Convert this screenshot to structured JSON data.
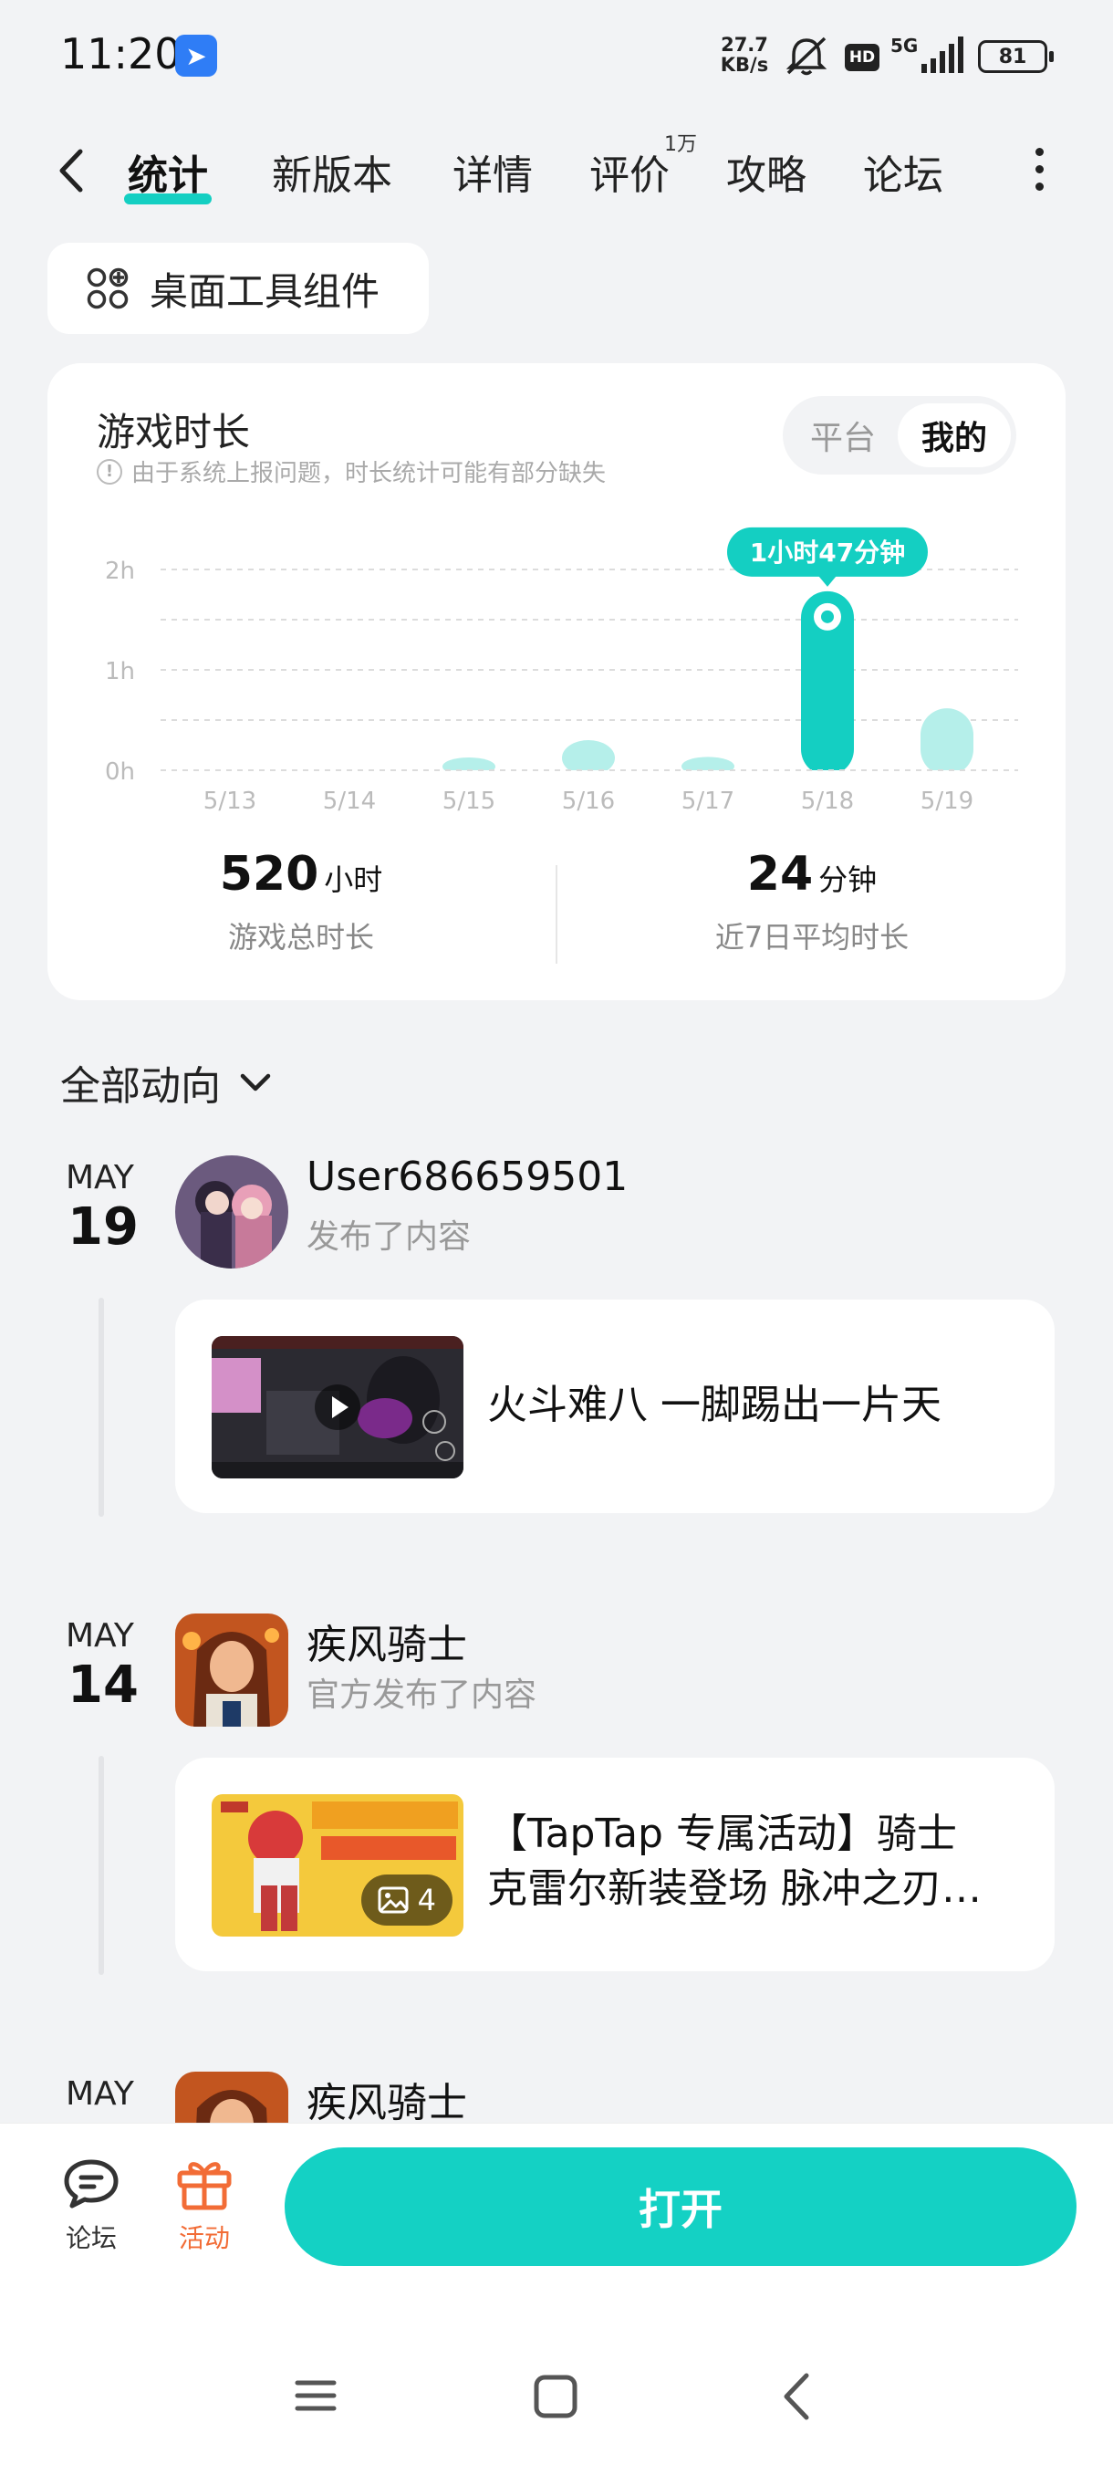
{
  "status_bar": {
    "time": "11:20",
    "net_speed_value": "27.7",
    "net_speed_unit": "KB/s",
    "network": "5G",
    "hd": "HD",
    "battery": "81"
  },
  "tabs": [
    {
      "label": "统计",
      "active": true
    },
    {
      "label": "新版本"
    },
    {
      "label": "详情"
    },
    {
      "label": "评价",
      "badge": "1万"
    },
    {
      "label": "攻略"
    },
    {
      "label": "论坛"
    }
  ],
  "widget_chip": {
    "label": "桌面工具组件"
  },
  "stats": {
    "title": "游戏时长",
    "note": "由于系统上报问题，时长统计可能有部分缺失",
    "segments": {
      "platform": "平台",
      "mine": "我的"
    },
    "total_value": "520",
    "total_unit": "小时",
    "total_label": "游戏总时长",
    "avg_value": "24",
    "avg_unit": "分钟",
    "avg_label": "近7日平均时长"
  },
  "chart_data": {
    "type": "bar",
    "categories": [
      "5/13",
      "5/14",
      "5/15",
      "5/16",
      "5/17",
      "5/18",
      "5/19"
    ],
    "values_minutes": [
      0,
      0,
      6,
      18,
      8,
      107,
      37
    ],
    "y_ticks": [
      "0h",
      "1h",
      "2h"
    ],
    "ylim_minutes": [
      0,
      120
    ],
    "highlight_index": 5,
    "highlight_label": "1小时47分钟",
    "bar_color": "#14cfc2",
    "faded_bar_color": "#b5efea",
    "grid": "dashed"
  },
  "feed": {
    "filter_label": "全部动向",
    "items": [
      {
        "month": "MAY",
        "day": "19",
        "author": "User686659501",
        "action": "发布了内容",
        "post_title_line1": "火斗难八 一脚踢出一片天",
        "post_title_line2": "",
        "thumb_type": "video"
      },
      {
        "month": "MAY",
        "day": "14",
        "author": "疾风骑士",
        "action": "官方发布了内容",
        "post_title_line1": "【TapTap 专属活动】骑士",
        "post_title_line2": "克雷尔新装登场 脉冲之刃…",
        "image_count": "4",
        "thumb_type": "image"
      },
      {
        "month": "MAY",
        "day": "",
        "author": "疾风骑士",
        "action": ""
      }
    ]
  },
  "bottom_bar": {
    "forum_label": "论坛",
    "activity_label": "活动",
    "open_label": "打开",
    "accent_color": "#14d1c4",
    "activity_color": "#f26c36"
  }
}
